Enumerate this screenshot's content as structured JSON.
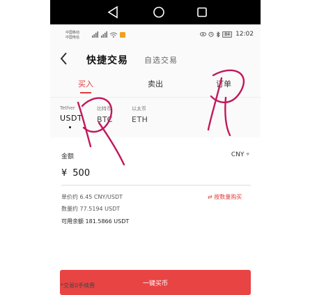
{
  "system_nav": {
    "back_icon": "triangle-back-icon",
    "home_icon": "circle-home-icon",
    "recent_icon": "square-recent-icon"
  },
  "status_bar": {
    "carrier_1": "中国移动",
    "carrier_2": "中国电信",
    "battery": "84",
    "time": "12:02"
  },
  "header": {
    "title": "快捷交易",
    "alt_title": "自选交易"
  },
  "tabs": [
    {
      "label": "买入"
    },
    {
      "label": "卖出"
    },
    {
      "label": "订单"
    }
  ],
  "coins": [
    {
      "name": "Tether",
      "symbol": "USDT"
    },
    {
      "name": "比特币",
      "symbol": "BTC"
    },
    {
      "name": "以太币",
      "symbol": "ETH"
    }
  ],
  "form": {
    "amount_label": "金额",
    "currency": "CNY",
    "currency_symbol": "¥",
    "amount_value": "500",
    "unit_price": "单价约 6.45 CNY/USDT",
    "quantity": "数量约 77.5194 USDT",
    "available": "可用余额 181.5866 USDT",
    "switch_mode": "按数量购买",
    "buy_button": "一键买币",
    "fee_note": "*交易0手续费"
  },
  "colors": {
    "accent": "#e84444",
    "scribble": "#c2185b"
  }
}
